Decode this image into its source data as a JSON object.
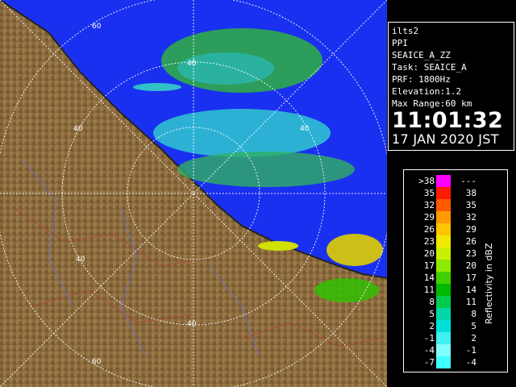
{
  "info": {
    "site": "ilts2",
    "scan_type": "PPI",
    "product": "SEAICE_A_ZZ",
    "task": "Task: SEAICE_A",
    "prf": "PRF: 1800Hz",
    "elevation": "Elevation:1.2",
    "max_range": "Max Range:60 km",
    "time": "11:01:32",
    "date": "17 JAN 2020 JST"
  },
  "legend": {
    "label": "Reflectivity in dBZ",
    "rows": [
      {
        "low": ">38",
        "high": "---",
        "color": "#ff00ff"
      },
      {
        "low": "35",
        "high": "38",
        "color": "#ff1a00"
      },
      {
        "low": "32",
        "high": "35",
        "color": "#ff5a00"
      },
      {
        "low": "29",
        "high": "32",
        "color": "#ff9a00"
      },
      {
        "low": "26",
        "high": "29",
        "color": "#ffc400"
      },
      {
        "low": "23",
        "high": "26",
        "color": "#f0e800"
      },
      {
        "low": "20",
        "high": "23",
        "color": "#c8f000"
      },
      {
        "low": "17",
        "high": "20",
        "color": "#90e800"
      },
      {
        "low": "14",
        "high": "17",
        "color": "#40d000"
      },
      {
        "low": "11",
        "high": "14",
        "color": "#00b800"
      },
      {
        "low": "8",
        "high": "11",
        "color": "#00cc50"
      },
      {
        "low": "5",
        "high": "8",
        "color": "#00d8a8"
      },
      {
        "low": "2",
        "high": "5",
        "color": "#00e0d8"
      },
      {
        "low": "-1",
        "high": "2",
        "color": "#40f0f0"
      },
      {
        "low": "-4",
        "high": "-1",
        "color": "#80ffff"
      },
      {
        "low": "-7",
        "high": "-4",
        "color": "#40ffff"
      }
    ]
  },
  "range_rings": {
    "labels": [
      "60",
      "40",
      "40",
      "40",
      "40",
      "40",
      "60"
    ]
  },
  "colors": {
    "sea": "#1a30f0",
    "land": "#8a6a3c",
    "coast": "#2a2420",
    "range_ring": "#ffffff"
  }
}
